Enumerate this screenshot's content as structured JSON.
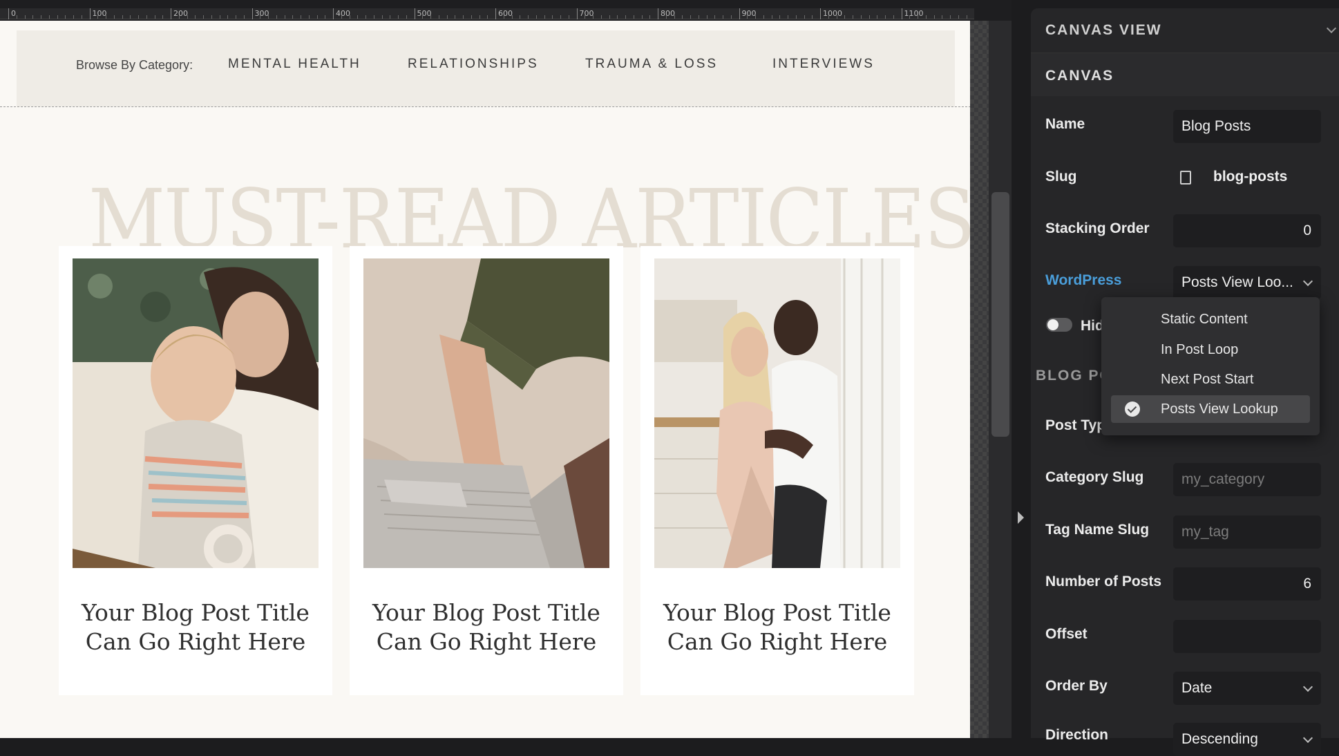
{
  "ruler": {
    "ticks": [
      "0",
      "100",
      "200",
      "300",
      "400",
      "500",
      "600",
      "700",
      "800",
      "900",
      "1000",
      "1100"
    ]
  },
  "nav": {
    "browse_label": "Browse By Category:",
    "links": [
      "MENTAL HEALTH",
      "RELATIONSHIPS",
      "TRAUMA & LOSS",
      "INTERVIEWS"
    ]
  },
  "hero": {
    "title": "MUST-READ ARTICLES"
  },
  "cards": [
    {
      "line1": "Your Blog Post Title",
      "line2": "Can Go Right Here"
    },
    {
      "line1": "Your Blog Post Title",
      "line2": "Can Go Right Here"
    },
    {
      "line1": "Your Blog Post Title",
      "line2": "Can Go Right Here"
    }
  ],
  "inspector": {
    "canvas_view_heading": "CANVAS VIEW",
    "canvas_heading": "CANVAS",
    "name_label": "Name",
    "name_value": "Blog Posts",
    "slug_label": "Slug",
    "slug_value": "blog-posts",
    "stacking_label": "Stacking Order",
    "stacking_value": "0",
    "wordpress_label": "WordPress",
    "wordpress_value": "Posts View Loo...",
    "hide_label": "Hid",
    "blog_heading": "BLOG PO",
    "post_type_label": "Post Typ",
    "category_label": "Category Slug",
    "category_placeholder": "my_category",
    "tag_label": "Tag Name Slug",
    "tag_placeholder": "my_tag",
    "num_posts_label": "Number of Posts",
    "num_posts_value": "6",
    "offset_label": "Offset",
    "offset_value": "",
    "order_by_label": "Order By",
    "order_by_value": "Date",
    "direction_label": "Direction",
    "direction_value": "Descending"
  },
  "dropdown": {
    "options": [
      "Static Content",
      "In Post Loop",
      "Next Post Start",
      "Posts View Lookup"
    ],
    "selected": "Posts View Lookup"
  },
  "colors": {
    "accent_link": "#4a9eda",
    "page_bg": "#faf8f4",
    "nav_bg": "#efece6",
    "panel_bg": "#262628"
  }
}
